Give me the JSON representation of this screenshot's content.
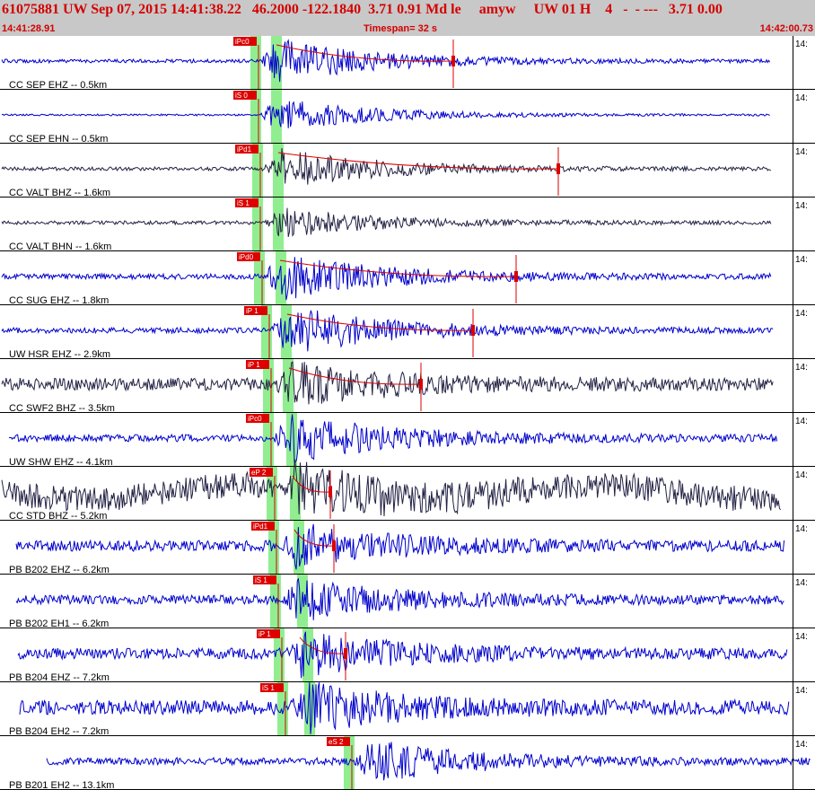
{
  "header": {
    "event_line": "61075881 UW Sep 07, 2015 14:41:38.22   46.2000 -122.1840  3.71 0.91 Md le     amyw     UW 01 H    4   -  - ---   3.71 0.00",
    "start_time": "14:41:28.91",
    "timespan": "Timespan=  32 s",
    "end_time": "14:42:00.73"
  },
  "colors": {
    "header_bg": "#c8c8c8",
    "header_text": "#d40000",
    "blue": "#0000cc",
    "dark": "#222244",
    "pick": "#dd0000",
    "band": "#90ee90"
  },
  "traces": [
    {
      "label": "CC SEP EHZ -- 0.5km",
      "tick": "14:",
      "phase": "iPc0",
      "color": "blue"
    },
    {
      "label": "CC SEP EHN -- 0.5km",
      "tick": "14:",
      "phase": "iS 0",
      "color": "blue"
    },
    {
      "label": "CC VALT BHZ -- 1.6km",
      "tick": "14:",
      "phase": "iPd1",
      "color": "dark"
    },
    {
      "label": "CC VALT BHN -- 1.6km",
      "tick": "14:",
      "phase": "iS 1",
      "color": "dark"
    },
    {
      "label": "CC SUG EHZ -- 1.8km",
      "tick": "14:",
      "phase": "iPd0",
      "color": "blue"
    },
    {
      "label": "UW HSR EHZ -- 2.9km",
      "tick": "14:",
      "phase": "iP 1",
      "color": "blue"
    },
    {
      "label": "CC SWF2 BHZ -- 3.5km",
      "tick": "14:",
      "phase": "iP 1",
      "color": "dark"
    },
    {
      "label": "UW SHW EHZ -- 4.1km",
      "tick": "14:",
      "phase": "iPc0",
      "color": "blue"
    },
    {
      "label": "CC STD BHZ -- 5.2km",
      "tick": "14:",
      "phase": "eP 2",
      "color": "dark"
    },
    {
      "label": "PB B202 EHZ -- 6.2km",
      "tick": "14:",
      "phase": "iPd1",
      "color": "blue"
    },
    {
      "label": "PB B202 EH1 -- 6.2km",
      "tick": "14:",
      "phase": "iS 1",
      "color": "blue"
    },
    {
      "label": "PB B204 EHZ -- 7.2km",
      "tick": "14:",
      "phase": "iP 1",
      "color": "blue"
    },
    {
      "label": "PB B204 EH2 -- 7.2km",
      "tick": "14:",
      "phase": "iS 1",
      "color": "blue"
    },
    {
      "label": "PB B201 EH2 -- 13.1km",
      "tick": "14:",
      "phase": "eS 2",
      "color": "blue"
    }
  ]
}
